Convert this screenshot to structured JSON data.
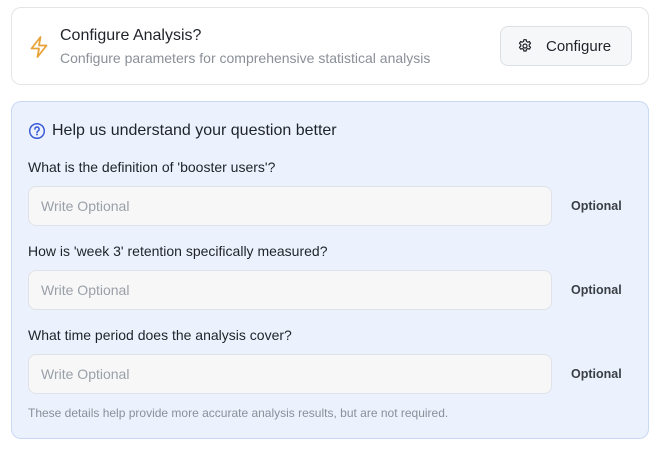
{
  "config": {
    "title": "Configure Analysis?",
    "subtitle": "Configure parameters for comprehensive statistical analysis",
    "button_label": "Configure",
    "icon": "lightning-bolt-icon",
    "button_icon": "gear-icon",
    "accent_color": "#e8a23a"
  },
  "help": {
    "title": "Help us understand your question better",
    "icon": "question-circle-icon",
    "accent_color": "#3b5bd9",
    "questions": [
      {
        "label": "What is the definition of 'booster users'?",
        "placeholder": "Write Optional",
        "value": "",
        "tag": "Optional"
      },
      {
        "label": "How is 'week 3' retention specifically measured?",
        "placeholder": "Write Optional",
        "value": "",
        "tag": "Optional"
      },
      {
        "label": "What time period does the analysis cover?",
        "placeholder": "Write Optional",
        "value": "",
        "tag": "Optional"
      }
    ],
    "footnote": "These details help provide more accurate analysis results, but are not required."
  }
}
